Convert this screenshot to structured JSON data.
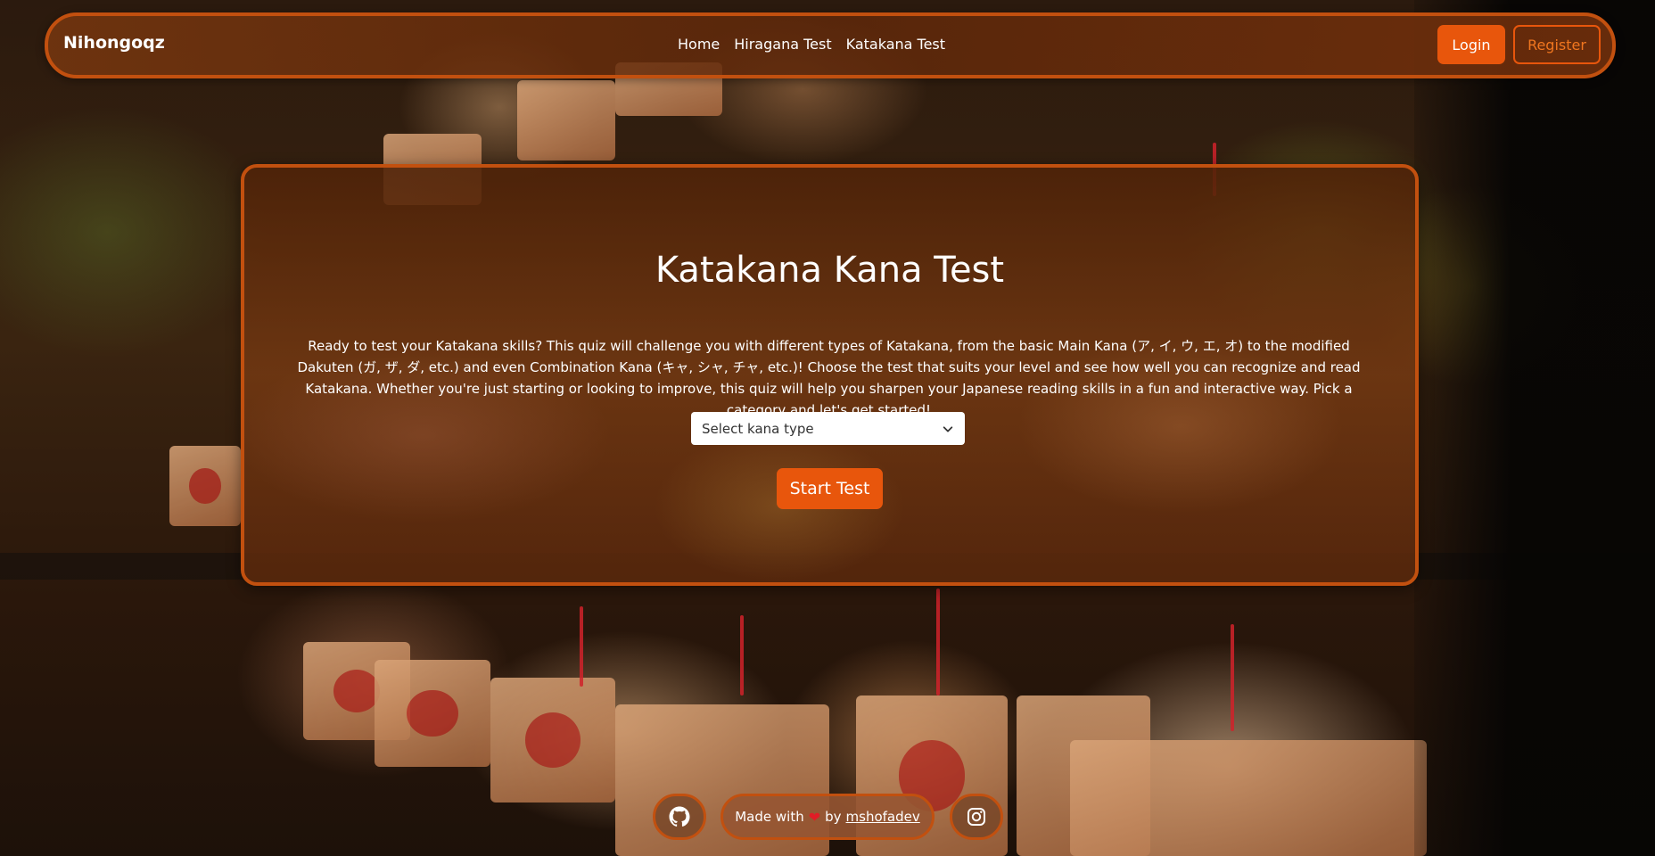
{
  "navbar": {
    "brand": "Nihongoqz",
    "links": [
      "Home",
      "Hiragana Test",
      "Katakana Test"
    ],
    "login_label": "Login",
    "register_label": "Register"
  },
  "main": {
    "title": "Katakana Kana Test",
    "description": "Ready to test your Katakana skills? This quiz will challenge you with different types of Katakana, from the basic Main Kana (ア, イ, ウ, エ, オ) to the modified Dakuten (ガ, ザ, ダ, etc.) and even Combination Kana (キャ, シャ, チャ, etc.)! Choose the test that suits your level and see how well you can recognize and read Katakana. Whether you're just starting or looking to improve, this quiz will help you sharpen your Japanese reading skills in a fun and interactive way. Pick a category and let's get started!",
    "select_placeholder": "Select kana type",
    "start_label": "Start Test"
  },
  "footer": {
    "made_with": "Made with",
    "heart_icon": "heart-icon",
    "by": "by",
    "author": "mshofadev",
    "github_icon": "github-icon",
    "instagram_icon": "instagram-icon"
  },
  "colors": {
    "accent": "#e8560c",
    "border": "#c2500f"
  }
}
